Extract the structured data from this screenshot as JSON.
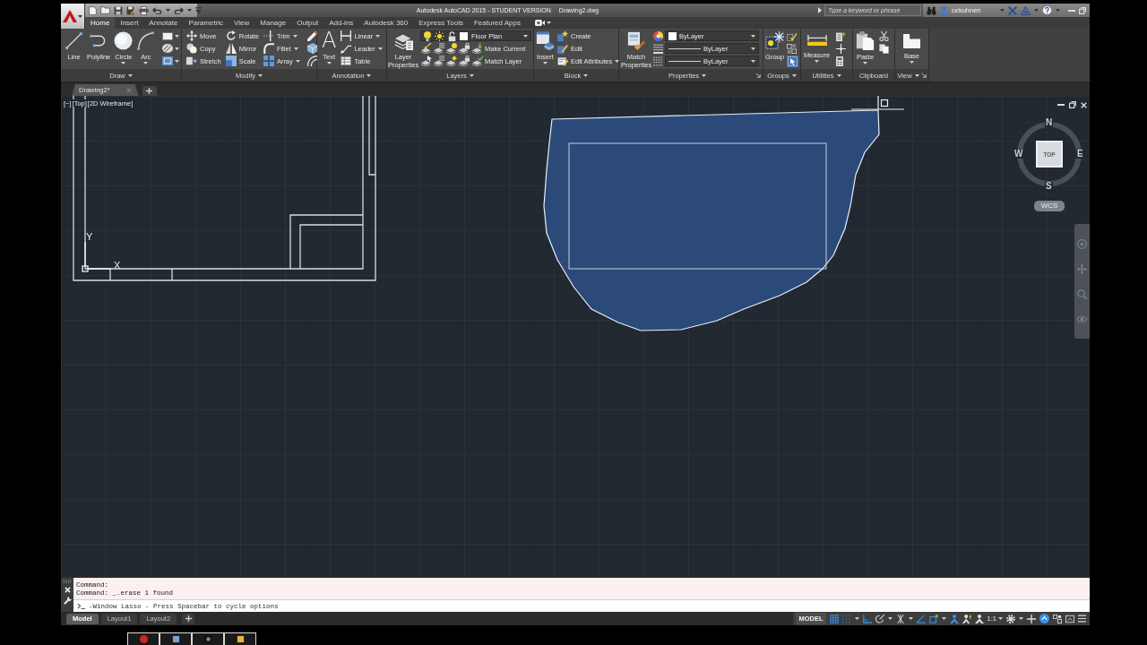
{
  "title_bar": {
    "title": "Autodesk AutoCAD 2015 - STUDENT VERSION",
    "file": "Drawing2.dwg",
    "search": {
      "placeholder": "Type a keyword or phrase"
    },
    "user": "cekuhnen"
  },
  "ribbon_tabs": [
    {
      "label": "Home",
      "selected": true
    },
    {
      "label": "Insert",
      "selected": false
    },
    {
      "label": "Annotate",
      "selected": false
    },
    {
      "label": "Parametric",
      "selected": false
    },
    {
      "label": "View",
      "selected": false
    },
    {
      "label": "Manage",
      "selected": false
    },
    {
      "label": "Output",
      "selected": false
    },
    {
      "label": "Add-ins",
      "selected": false
    },
    {
      "label": "Autodesk 360",
      "selected": false
    },
    {
      "label": "Express Tools",
      "selected": false
    },
    {
      "label": "Featured Apps",
      "selected": false
    }
  ],
  "ribbon": {
    "draw": {
      "title": "Draw",
      "tools": [
        "Line",
        "Polyline",
        "Circle",
        "Arc"
      ]
    },
    "modify": {
      "title": "Modify",
      "tools": [
        "Move",
        "Rotate",
        "Trim",
        "Copy",
        "Mirror",
        "Fillet",
        "Stretch",
        "Scale",
        "Array"
      ]
    },
    "annotation": {
      "title": "Annotation",
      "text_glyph": "A",
      "text_tool": "Text",
      "tools": [
        "Linear",
        "Leader",
        "Table"
      ]
    },
    "layers": {
      "title": "Layers",
      "layer_properties": "Layer Properties",
      "current_layer": "Floor Plan",
      "tools": [
        "Make Current",
        "Match Layer"
      ]
    },
    "block": {
      "title": "Block",
      "insert": "Insert",
      "tools": [
        "Create",
        "Edit",
        "Edit Attributes"
      ]
    },
    "properties": {
      "title": "Properties",
      "match_properties": "Match Properties",
      "object_color_setting": "ByLayer",
      "lineweight_setting": "ByLayer",
      "linetype_setting": "ByLayer"
    },
    "groups": {
      "title": "Groups",
      "group": "Group",
      "group_selection": {
        "on": true
      }
    },
    "utilities": {
      "title": "Utilities",
      "measure": "Measure"
    },
    "clipboard": {
      "title": "Clipboard",
      "paste": "Paste"
    },
    "view": {
      "title": "View",
      "base": "Base"
    }
  },
  "file_tabs": [
    {
      "label": "Drawing2*",
      "selected": true
    }
  ],
  "viewport": {
    "controls": [
      "[−]",
      "[Top]",
      "[2D Wireframe]"
    ],
    "ucs": {
      "y": "Y",
      "x": "X"
    },
    "viewcube": {
      "north": "N",
      "west": "W",
      "face": "TOP",
      "east": "E",
      "south": "S",
      "coordinate_system": "WCS"
    }
  },
  "command_line": {
    "history": [
      "Command:",
      "Command: _.erase 1 found"
    ],
    "prompt": "-Window Lasso - Press Spacebar to cycle options"
  },
  "layout_tabs": [
    {
      "label": "Model",
      "selected": true
    },
    {
      "label": "Layout1",
      "selected": false
    },
    {
      "label": "Layout2",
      "selected": false
    }
  ],
  "status_bar": {
    "space": "MODEL",
    "toggles": [
      {
        "on": true
      },
      {
        "on": true
      },
      {
        "on": true
      },
      {
        "on": false
      },
      {
        "on": false
      },
      {
        "on": true
      },
      {
        "on": true
      },
      {
        "on": true
      },
      {
        "on": false
      },
      {
        "on": true
      }
    ],
    "annotation_scale": "1:1"
  }
}
